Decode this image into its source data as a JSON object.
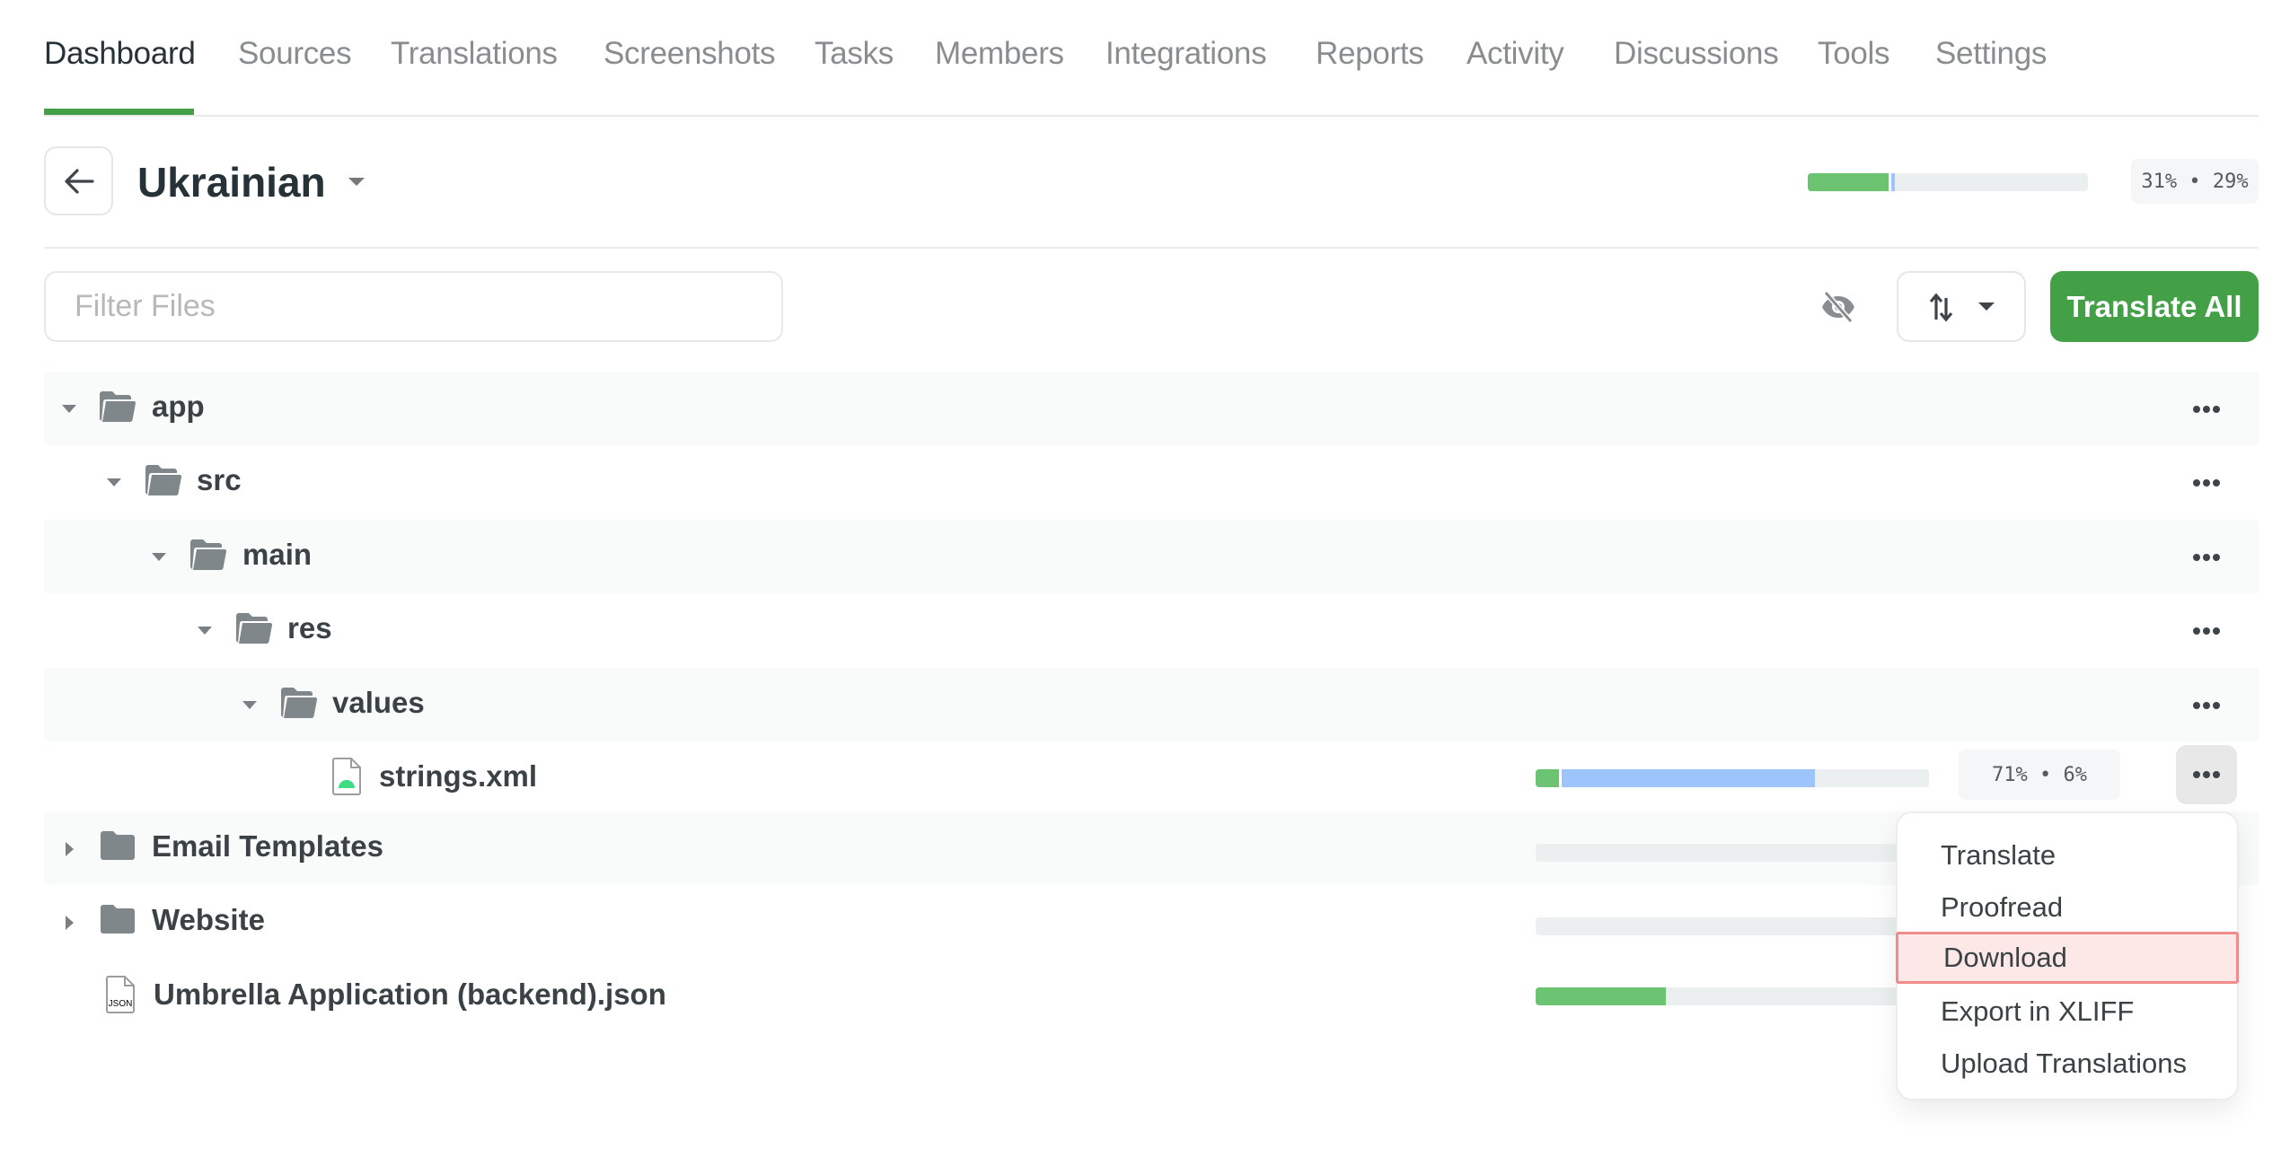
{
  "tabs": [
    {
      "label": "Dashboard",
      "active": true
    },
    {
      "label": "Sources"
    },
    {
      "label": "Translations"
    },
    {
      "label": "Screenshots"
    },
    {
      "label": "Tasks"
    },
    {
      "label": "Members"
    },
    {
      "label": "Integrations"
    },
    {
      "label": "Reports"
    },
    {
      "label": "Activity"
    },
    {
      "label": "Discussions"
    },
    {
      "label": "Tools"
    },
    {
      "label": "Settings"
    }
  ],
  "header": {
    "back_icon": "arrow-left-icon",
    "language": "Ukrainian",
    "progress": {
      "translated": 31,
      "approved": 29
    },
    "badge": "31% • 29%"
  },
  "toolbar": {
    "filter_placeholder": "Filter Files",
    "filter_value": "",
    "hide_icon": "eye-off-icon",
    "sort_icon": "sort-arrows-icon",
    "translate_all_label": "Translate All"
  },
  "colors": {
    "accent": "#43a047",
    "approved": "#6cc473",
    "translated": "#9ec5fb",
    "highlight_border": "#f08c8c",
    "highlight_fill": "#fde8e8"
  },
  "tree": [
    {
      "name": "app",
      "type": "folder-open",
      "expanded": true
    },
    {
      "name": "src",
      "type": "folder-open",
      "expanded": true
    },
    {
      "name": "main",
      "type": "folder-open",
      "expanded": true
    },
    {
      "name": "res",
      "type": "folder-open",
      "expanded": true
    },
    {
      "name": "values",
      "type": "folder-open",
      "expanded": true
    },
    {
      "name": "strings.xml",
      "type": "android-file",
      "progress": {
        "translated": 71,
        "approved": 6
      },
      "badge": "71% • 6%"
    },
    {
      "name": "Email Templates",
      "type": "folder",
      "expanded": false,
      "progress": {
        "translated": 0,
        "approved": 0
      }
    },
    {
      "name": "Website",
      "type": "folder",
      "expanded": false,
      "progress": {
        "translated": 0,
        "approved": 0
      }
    },
    {
      "name": "Umbrella Application (backend).json",
      "type": "json-file",
      "progress": {
        "translated": 33,
        "approved": 33
      }
    }
  ],
  "context_menu": {
    "items": [
      "Translate",
      "Proofread",
      "Download",
      "Export in XLIFF",
      "Upload Translations"
    ],
    "highlighted": "Download"
  },
  "json_icon_label": "JSON"
}
